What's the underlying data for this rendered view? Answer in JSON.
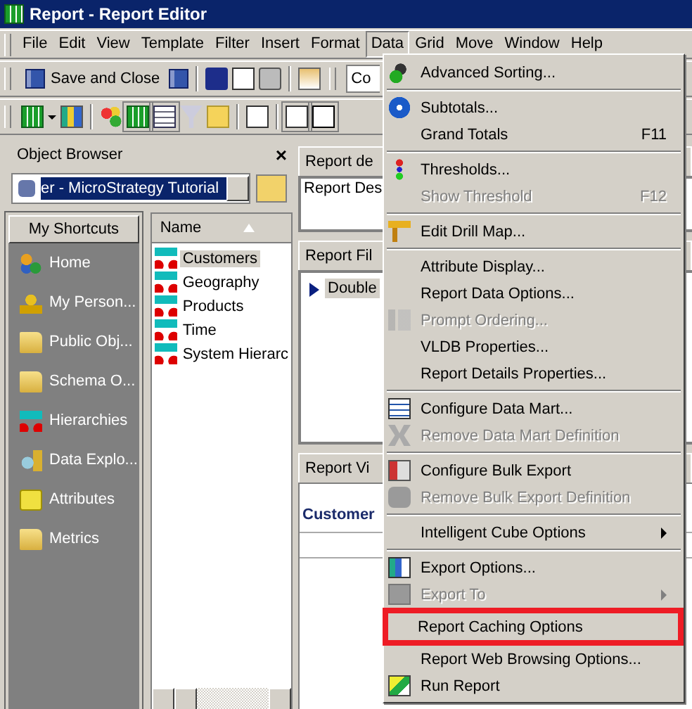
{
  "window": {
    "title": "Report - Report Editor"
  },
  "menubar": [
    {
      "label": "File",
      "selected": false
    },
    {
      "label": "Edit",
      "selected": false
    },
    {
      "label": "View",
      "selected": false
    },
    {
      "label": "Template",
      "selected": false
    },
    {
      "label": "Filter",
      "selected": false
    },
    {
      "label": "Insert",
      "selected": false
    },
    {
      "label": "Format",
      "selected": false
    },
    {
      "label": "Data",
      "selected": true
    },
    {
      "label": "Grid",
      "selected": false
    },
    {
      "label": "Move",
      "selected": false
    },
    {
      "label": "Window",
      "selected": false
    },
    {
      "label": "Help",
      "selected": false
    }
  ],
  "toolbar": {
    "save_button": "Save and Close",
    "combo_value": "Co"
  },
  "object_browser": {
    "title": "Object Browser",
    "close": "×",
    "project": "er - MicroStrategy Tutorial",
    "shortcuts_header": "My Shortcuts",
    "shortcuts": [
      "Home",
      "My Person...",
      "Public Obj...",
      "Schema O...",
      "Hierarchies",
      "Data Explo...",
      "Attributes",
      "Metrics"
    ],
    "name_column": "Name",
    "names": [
      {
        "label": "Customers",
        "selected": true
      },
      {
        "label": "Geography",
        "selected": false
      },
      {
        "label": "Products",
        "selected": false
      },
      {
        "label": "Time",
        "selected": false
      },
      {
        "label": "System Hierarc",
        "selected": false
      }
    ]
  },
  "report_details": {
    "title": "Report de",
    "text": "Report Des"
  },
  "report_filter": {
    "title": "Report Fil",
    "item": "Double"
  },
  "report_view": {
    "title": "Report Vi",
    "header": "Customer"
  },
  "data_menu": [
    {
      "kind": "item",
      "label": "Advanced Sorting...",
      "disabled": false
    },
    {
      "kind": "separator"
    },
    {
      "kind": "item",
      "label": "Subtotals...",
      "disabled": false
    },
    {
      "kind": "item",
      "label": "Grand Totals",
      "disabled": false,
      "shortcut": "F11"
    },
    {
      "kind": "separator"
    },
    {
      "kind": "item",
      "label": "Thresholds...",
      "disabled": false
    },
    {
      "kind": "item",
      "label": "Show Threshold",
      "disabled": true,
      "shortcut": "F12"
    },
    {
      "kind": "separator"
    },
    {
      "kind": "item",
      "label": "Edit Drill Map...",
      "disabled": false
    },
    {
      "kind": "separator"
    },
    {
      "kind": "item",
      "label": "Attribute Display...",
      "disabled": false
    },
    {
      "kind": "item",
      "label": "Report Data Options...",
      "disabled": false
    },
    {
      "kind": "item",
      "label": "Prompt Ordering...",
      "disabled": true
    },
    {
      "kind": "item",
      "label": "VLDB Properties...",
      "disabled": false
    },
    {
      "kind": "item",
      "label": "Report Details Properties...",
      "disabled": false
    },
    {
      "kind": "separator"
    },
    {
      "kind": "item",
      "label": "Configure Data Mart...",
      "disabled": false
    },
    {
      "kind": "item",
      "label": "Remove Data Mart Definition",
      "disabled": true
    },
    {
      "kind": "separator"
    },
    {
      "kind": "item",
      "label": "Configure Bulk Export",
      "disabled": false
    },
    {
      "kind": "item",
      "label": "Remove Bulk Export Definition",
      "disabled": true
    },
    {
      "kind": "separator"
    },
    {
      "kind": "item",
      "label": "Intelligent Cube Options",
      "disabled": false,
      "submenu": true
    },
    {
      "kind": "separator"
    },
    {
      "kind": "item",
      "label": "Export Options...",
      "disabled": false
    },
    {
      "kind": "item",
      "label": "Export To",
      "disabled": true,
      "submenu": true
    },
    {
      "kind": "item",
      "label": "Report Caching Options",
      "disabled": false,
      "highlighted": true
    },
    {
      "kind": "item",
      "label": "Report Web Browsing Options...",
      "disabled": false
    },
    {
      "kind": "item",
      "label": "Run Report",
      "disabled": false
    }
  ]
}
